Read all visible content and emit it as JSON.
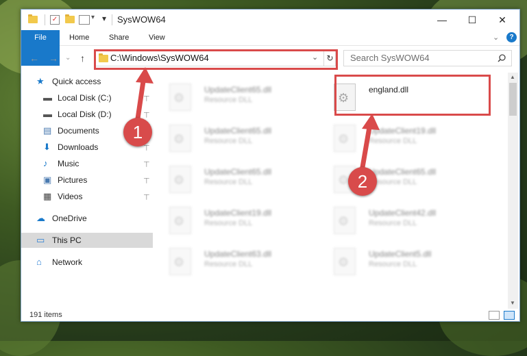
{
  "window": {
    "title": "SysWOW64",
    "minimize": "—",
    "maximize": "☐",
    "close": "✕"
  },
  "ribbon": {
    "tabs": [
      "File",
      "Home",
      "Share",
      "View"
    ],
    "collapse": "⌄",
    "help": "?"
  },
  "nav": {
    "back": "←",
    "forward": "→",
    "recent": "⌄",
    "up": "↑",
    "address": "C:\\Windows\\SysWOW64",
    "address_dropdown": "⌄",
    "refresh": "↻",
    "search_placeholder": "Search SysWOW64",
    "search_icon": "search-icon"
  },
  "sidebar": {
    "items": [
      {
        "label": "Quick access",
        "icon": "star-icon",
        "pinned": false
      },
      {
        "label": "Local Disk (C:)",
        "icon": "drive-icon",
        "pinned": true
      },
      {
        "label": "Local Disk (D:)",
        "icon": "drive-icon",
        "pinned": true
      },
      {
        "label": "Documents",
        "icon": "documents-icon",
        "pinned": true
      },
      {
        "label": "Downloads",
        "icon": "download-icon",
        "pinned": true
      },
      {
        "label": "Music",
        "icon": "music-icon",
        "pinned": true
      },
      {
        "label": "Pictures",
        "icon": "pictures-icon",
        "pinned": true
      },
      {
        "label": "Videos",
        "icon": "videos-icon",
        "pinned": true
      },
      {
        "label": "OneDrive",
        "icon": "cloud-icon",
        "pinned": false
      },
      {
        "label": "This PC",
        "icon": "computer-icon",
        "pinned": false,
        "selected": true
      },
      {
        "label": "Network",
        "icon": "network-icon",
        "pinned": false
      }
    ],
    "pin_glyph": "📌"
  },
  "files": [
    {
      "name": "UpdateClient65.dll",
      "type": "Resource DLL",
      "blurred": true
    },
    {
      "name": "england.dll",
      "type": "",
      "blurred": false,
      "highlighted": true
    },
    {
      "name": "UpdateClient65.dll",
      "type": "Resource DLL",
      "blurred": true
    },
    {
      "name": "UpdateClient19.dll",
      "type": "Resource DLL",
      "blurred": true
    },
    {
      "name": "UpdateClient65.dll",
      "type": "Resource DLL",
      "blurred": true
    },
    {
      "name": "UpdateClient65.dll",
      "type": "Resource DLL",
      "blurred": true
    },
    {
      "name": "UpdateClient19.dll",
      "type": "Resource DLL",
      "blurred": true
    },
    {
      "name": "UpdateClient42.dll",
      "type": "Resource DLL",
      "blurred": true
    },
    {
      "name": "UpdateClient63.dll",
      "type": "Resource DLL",
      "blurred": true
    },
    {
      "name": "UpdateClient5.dll",
      "type": "Resource DLL",
      "blurred": true
    }
  ],
  "status": {
    "items": "191 items"
  },
  "annotations": {
    "badge1": "1",
    "badge2": "2",
    "color": "#d94a4a"
  }
}
